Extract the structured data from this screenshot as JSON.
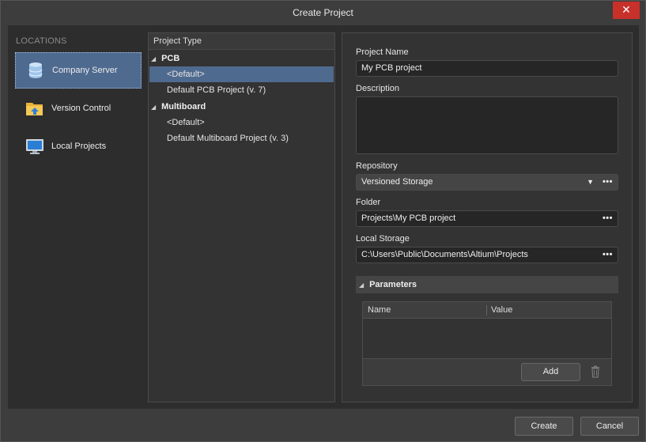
{
  "window": {
    "title": "Create Project",
    "close_glyph": "✕"
  },
  "locations": {
    "header": "LOCATIONS",
    "items": [
      {
        "label": "Company Server",
        "icon": "database-icon",
        "selected": true
      },
      {
        "label": "Version Control",
        "icon": "folder-upload-icon",
        "selected": false
      },
      {
        "label": "Local Projects",
        "icon": "monitor-icon",
        "selected": false
      }
    ]
  },
  "project_type": {
    "header": "Project Type",
    "groups": [
      {
        "label": "PCB",
        "items": [
          "<Default>",
          "Default PCB Project (v. 7)"
        ]
      },
      {
        "label": "Multiboard",
        "items": [
          "<Default>",
          "Default Multiboard Project (v. 3)"
        ]
      }
    ],
    "selected_item": "PCB/<Default>"
  },
  "form": {
    "project_name_label": "Project Name",
    "project_name_value": "My PCB project",
    "description_label": "Description",
    "description_value": "",
    "repository_label": "Repository",
    "repository_value": "Versioned Storage",
    "folder_label": "Folder",
    "folder_value": "Projects\\My PCB project",
    "local_storage_label": "Local Storage",
    "local_storage_value": "C:\\Users\\Public\\Documents\\Altium\\Projects",
    "ellipsis": "•••",
    "parameters": {
      "header": "Parameters",
      "col_name": "Name",
      "col_value": "Value",
      "add_label": "Add"
    }
  },
  "footer": {
    "create_label": "Create",
    "cancel_label": "Cancel"
  },
  "colors": {
    "selection": "#4f6a8f",
    "close_button": "#c8302a",
    "background": "#2d2d2d"
  }
}
